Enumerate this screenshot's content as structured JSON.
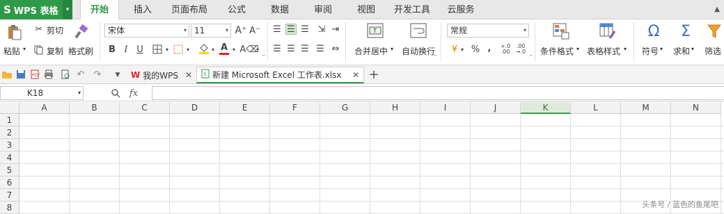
{
  "app": {
    "title": "WPS 表格",
    "logo": "S"
  },
  "menu": {
    "tabs": [
      "开始",
      "插入",
      "页面布局",
      "公式",
      "数据",
      "审阅",
      "视图",
      "开发工具",
      "云服务"
    ],
    "active": "开始"
  },
  "ribbon": {
    "paste": "粘贴",
    "cut": "剪切",
    "copy": "复制",
    "format_painter": "格式刷",
    "font_name": "宋体",
    "font_size": "11",
    "merge_center": "合并居中",
    "wrap_text": "自动换行",
    "number_format": "常规",
    "percent": "%",
    "comma": ",",
    "conditional_format": "条件格式",
    "table_style": "表格样式",
    "symbol": "符号",
    "sum": "求和",
    "filter": "筛选"
  },
  "doc_tabs": [
    {
      "label": "我的WPS"
    },
    {
      "label": "新建 Microsoft Excel 工作表.xlsx"
    }
  ],
  "formula": {
    "name_box": "K18",
    "fx": "fx"
  },
  "columns": [
    "A",
    "B",
    "C",
    "D",
    "E",
    "F",
    "G",
    "H",
    "I",
    "J",
    "K",
    "L",
    "M",
    "N"
  ],
  "selected_column": "K",
  "rows": [
    "1",
    "2",
    "3",
    "4",
    "5",
    "6",
    "7",
    "8"
  ],
  "watermark": "头条号 / 蓝色的鱼尾吧"
}
